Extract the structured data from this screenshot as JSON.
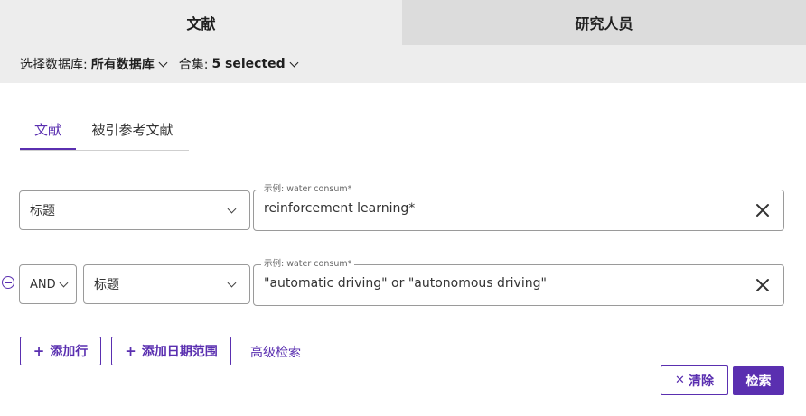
{
  "top_tabs": {
    "documents": "文献",
    "researchers": "研究人员"
  },
  "db_bar": {
    "database_label": "选择数据库:",
    "database_value": "所有数据库",
    "collection_label": "合集:",
    "collection_value": "5 selected"
  },
  "sub_tabs": {
    "documents": "文献",
    "cited_references": "被引参考文献"
  },
  "rows": [
    {
      "field": "标题",
      "placeholder_label": "示例: water consum*",
      "value": "reinforcement learning*"
    },
    {
      "operator": "AND",
      "field": "标题",
      "placeholder_label": "示例: water consum*",
      "value": "\"automatic driving\" or \"autonomous driving\""
    }
  ],
  "actions": {
    "add_row": "添加行",
    "add_date_range": "添加日期范围",
    "advanced_search": "高级检索",
    "clear": "清除",
    "search": "检索"
  },
  "colors": {
    "accent": "#5a2fb0",
    "bar_bg": "#ededed",
    "inactive_tab_bg": "#dcdcdc"
  },
  "icons": [
    "chevron-down-icon",
    "close-icon",
    "remove-circle-icon",
    "plus-icon"
  ]
}
